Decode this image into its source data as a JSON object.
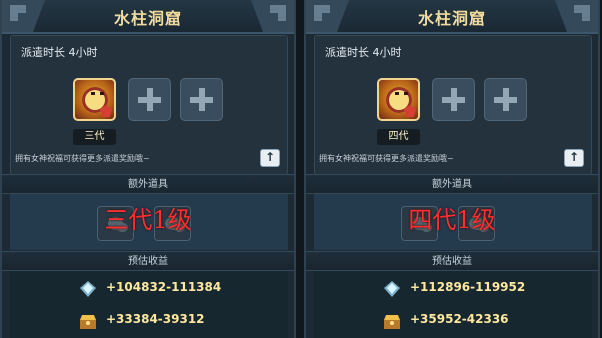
{
  "panels": [
    {
      "title": "水柱洞窟",
      "duration": "派遣时长 4小时",
      "generation": "三代",
      "note": "拥有女神祝福可获得更多派遣奖励哦~",
      "extra_items": "额外道具",
      "overlay": "三代1级",
      "estimated_income": "预估收益",
      "rewards": [
        "+104832-111384",
        "+33384-39312"
      ]
    },
    {
      "title": "水柱洞窟",
      "duration": "派遣时长 4小时",
      "generation": "四代",
      "note": "拥有女神祝福可获得更多派遣奖励哦~",
      "extra_items": "额外道具",
      "overlay": "四代1级",
      "estimated_income": "预估收益",
      "rewards": [
        "+112896-119952",
        "+35952-42336"
      ]
    }
  ],
  "icons": {
    "empty_slot": "plus-icon",
    "up": "up-arrow-icon",
    "experience": "experience-crystal-icon",
    "gold": "treasure-icon"
  }
}
